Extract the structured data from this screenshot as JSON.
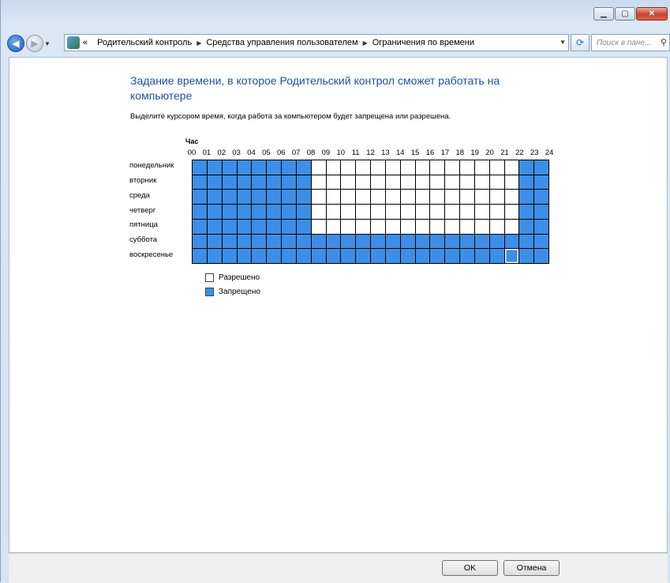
{
  "window": {
    "minimize_icon": "minimize-icon",
    "maximize_icon": "maximize-icon",
    "close_icon": "close-icon"
  },
  "nav": {
    "history_prefix": "«",
    "breadcrumbs": [
      "Родительский контроль",
      "Средства управления пользователем",
      "Ограничения по времени"
    ],
    "search_placeholder": "Поиск в пане..."
  },
  "page": {
    "title": "Задание времени, в которое Родительский контрол сможет работать на компьютере",
    "instruction": "Выделите курсором время, когда работа за компьютером будет запрещена или разрешена.",
    "hour_label": "Час",
    "hours": [
      "00",
      "01",
      "02",
      "03",
      "04",
      "05",
      "06",
      "07",
      "08",
      "09",
      "10",
      "11",
      "12",
      "13",
      "14",
      "15",
      "16",
      "17",
      "18",
      "19",
      "20",
      "21",
      "22",
      "23",
      "24"
    ],
    "days": [
      "понедельник",
      "вторник",
      "среда",
      "четверг",
      "пятница",
      "суббота",
      "воскресенье"
    ],
    "schedule": {
      "note": "1 = blocked (blue), 0 = allowed (white), per day 24 hours",
      "rows": [
        [
          1,
          1,
          1,
          1,
          1,
          1,
          1,
          1,
          0,
          0,
          0,
          0,
          0,
          0,
          0,
          0,
          0,
          0,
          0,
          0,
          0,
          0,
          1,
          1
        ],
        [
          1,
          1,
          1,
          1,
          1,
          1,
          1,
          1,
          0,
          0,
          0,
          0,
          0,
          0,
          0,
          0,
          0,
          0,
          0,
          0,
          0,
          0,
          1,
          1
        ],
        [
          1,
          1,
          1,
          1,
          1,
          1,
          1,
          1,
          0,
          0,
          0,
          0,
          0,
          0,
          0,
          0,
          0,
          0,
          0,
          0,
          0,
          0,
          1,
          1
        ],
        [
          1,
          1,
          1,
          1,
          1,
          1,
          1,
          1,
          0,
          0,
          0,
          0,
          0,
          0,
          0,
          0,
          0,
          0,
          0,
          0,
          0,
          0,
          1,
          1
        ],
        [
          1,
          1,
          1,
          1,
          1,
          1,
          1,
          1,
          0,
          0,
          0,
          0,
          0,
          0,
          0,
          0,
          0,
          0,
          0,
          0,
          0,
          0,
          1,
          1
        ],
        [
          1,
          1,
          1,
          1,
          1,
          1,
          1,
          1,
          1,
          1,
          1,
          1,
          1,
          1,
          1,
          1,
          1,
          1,
          1,
          1,
          1,
          1,
          1,
          1
        ],
        [
          1,
          1,
          1,
          1,
          1,
          1,
          1,
          1,
          1,
          1,
          1,
          1,
          1,
          1,
          1,
          1,
          1,
          1,
          1,
          1,
          1,
          1,
          1,
          1
        ]
      ]
    },
    "legend": {
      "allowed": "Разрешено",
      "blocked": "Запрещено"
    },
    "colors": {
      "blocked": "#3c8ee6",
      "allowed": "#ffffff",
      "title": "#1e50a2"
    }
  },
  "buttons": {
    "ok": "OK",
    "cancel": "Отмена"
  }
}
